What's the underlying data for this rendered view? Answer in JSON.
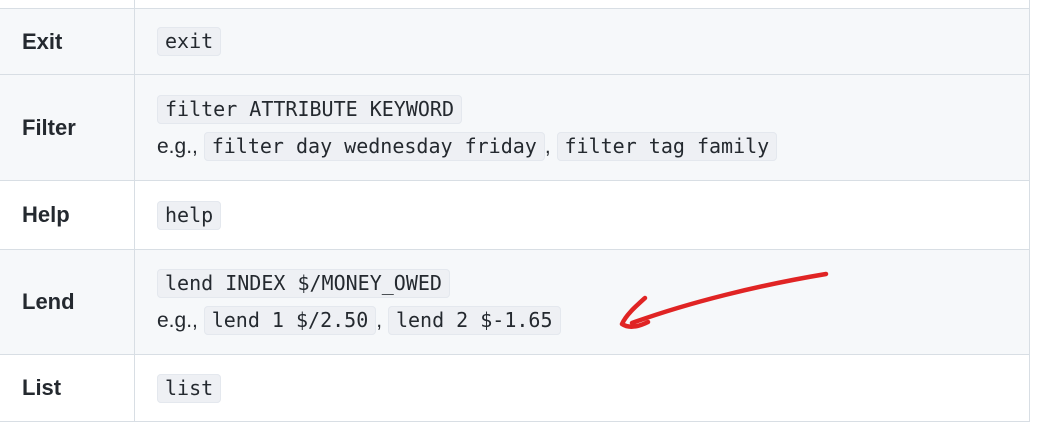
{
  "rows": [
    {
      "name": "",
      "lines": []
    },
    {
      "name": "Exit",
      "lines": [
        [
          "exit"
        ]
      ]
    },
    {
      "name": "Filter",
      "lines": [
        [
          "filter ATTRIBUTE KEYWORD"
        ],
        [
          "filter day wednesday friday",
          "filter tag family"
        ]
      ]
    },
    {
      "name": "Help",
      "lines": [
        [
          "help"
        ]
      ]
    },
    {
      "name": "Lend",
      "lines": [
        [
          "lend INDEX $/MONEY_OWED"
        ],
        [
          "lend 1 $/2.50",
          "lend 2 $-1.65"
        ]
      ]
    },
    {
      "name": "List",
      "lines": [
        [
          "list"
        ]
      ]
    }
  ],
  "example_prefix": "e.g.,",
  "separator": ",",
  "annotation": {
    "color": "#e02424"
  }
}
